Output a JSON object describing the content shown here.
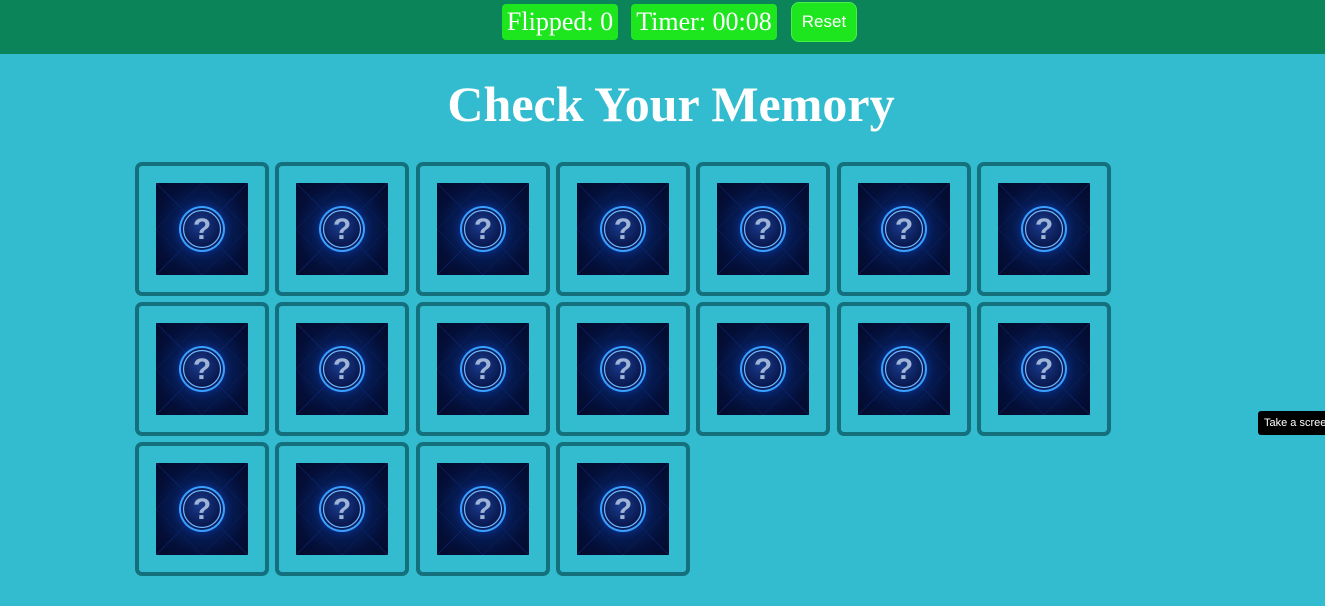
{
  "header": {
    "flipped_label": "Flipped: 0",
    "timer_label": "Timer: 00:08",
    "reset_label": "Reset",
    "colors": {
      "bar": "#0b8459",
      "badge": "#1ee61e",
      "page": "#33bccf"
    }
  },
  "game": {
    "title": "Check Your Memory",
    "flipped_count": 0,
    "elapsed": "00:08",
    "card_count": 18,
    "card_back_icon": "question-mark-icon",
    "card_back_symbol": "?"
  },
  "tooltip": {
    "text": "Take a screenshot"
  }
}
